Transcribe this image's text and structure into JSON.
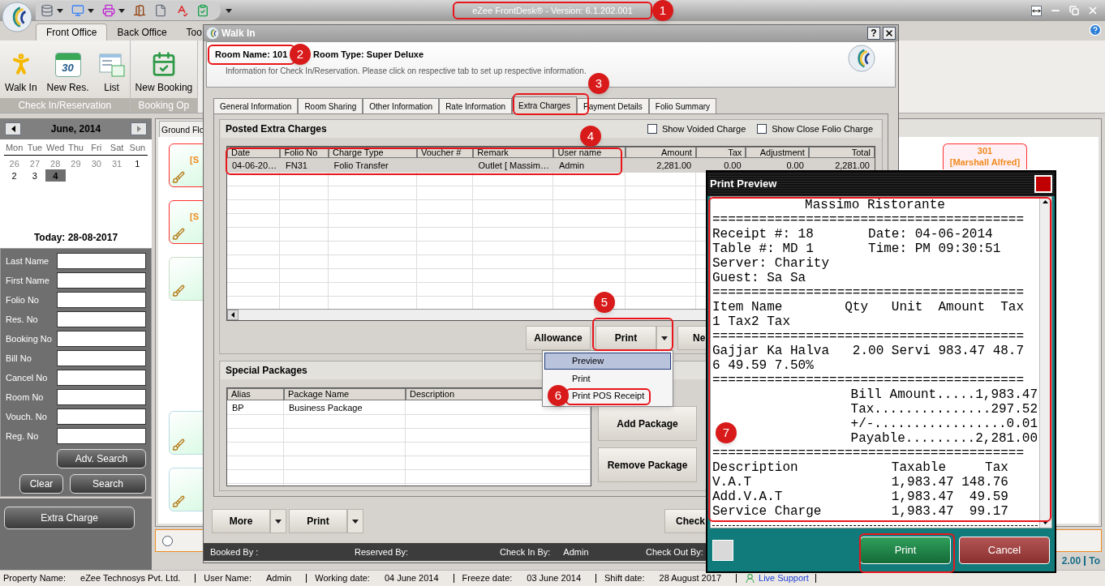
{
  "app": {
    "title": "eZee FrontDesk® - Version: 6.1.202.001"
  },
  "quick_toolbar": [
    {
      "kind": "database",
      "dropdown": true
    },
    {
      "kind": "monitor",
      "dropdown": true
    },
    {
      "kind": "printer",
      "dropdown": true
    },
    {
      "kind": "door",
      "dropdown": false
    },
    {
      "kind": "document",
      "dropdown": false
    },
    {
      "kind": "spellcheck",
      "dropdown": false
    },
    {
      "kind": "checklist",
      "dropdown": false
    }
  ],
  "ribbon_tabs": [
    {
      "label": "Front Office",
      "selected": true
    },
    {
      "label": "Back Office",
      "selected": false
    },
    {
      "label": "Too",
      "selected": false
    }
  ],
  "ribbon_groups": [
    {
      "label": "Check In/Reservation",
      "buttons": [
        {
          "kind": "walker",
          "label": "Walk In"
        },
        {
          "kind": "calendar",
          "label": "New Res.",
          "badge": "30"
        },
        {
          "kind": "list",
          "label": "List"
        }
      ]
    },
    {
      "label": "Booking Op",
      "buttons": [
        {
          "kind": "booking",
          "label": "New Booking"
        }
      ]
    }
  ],
  "calendar": {
    "month": "June, 2014",
    "weekdays": [
      "Mon",
      "Tue",
      "Wed",
      "Thu",
      "Fri",
      "Sat",
      "Sun"
    ],
    "days": [
      {
        "day": "26",
        "other_month": true,
        "selected": false
      },
      {
        "day": "27",
        "other_month": true,
        "selected": false
      },
      {
        "day": "28",
        "other_month": true,
        "selected": false
      },
      {
        "day": "29",
        "other_month": true,
        "selected": false
      },
      {
        "day": "30",
        "other_month": true,
        "selected": false
      },
      {
        "day": "31",
        "other_month": true,
        "selected": false
      },
      {
        "day": "1",
        "other_month": false,
        "selected": false
      },
      {
        "day": "2",
        "other_month": false,
        "selected": false
      },
      {
        "day": "3",
        "other_month": false,
        "selected": false
      },
      {
        "day": "4",
        "other_month": false,
        "selected": true
      }
    ],
    "today": "Today: 28-08-2017"
  },
  "search": {
    "fields": [
      "Last Name",
      "First Name",
      "Folio No",
      "Res. No",
      "Booking No",
      "Bill No",
      "Cancel No",
      "Room No",
      "Vouch. No",
      "Reg. No"
    ],
    "advanced": "Adv. Search",
    "clear": "Clear",
    "search": "Search"
  },
  "extra_charge_button": "Extra Charge",
  "floor_tab": "Ground Flo",
  "room_cards": [
    {
      "label": "[S",
      "color": "#ff3030"
    },
    {
      "label": "[S",
      "color": "#ff3030"
    },
    {
      "color": "#c8dcc8"
    },
    {
      "color": "#b8dce6"
    },
    {
      "color": "#b8dce6"
    }
  ],
  "featured_room": {
    "number": "301",
    "guest": "[Marshall Alfred]"
  },
  "bottom_strip": {
    "radio_selected": false,
    "value": "2.00",
    "label": "To"
  },
  "status_bar": [
    {
      "label": "Property Name:",
      "value": "eZee Technosys Pvt. Ltd."
    },
    {
      "label": "User Name:",
      "value": "Admin"
    },
    {
      "label": "Working date:",
      "value": "04 June 2014"
    },
    {
      "label": "Freeze date:",
      "value": "03 June 2014"
    },
    {
      "label": "Shift date:",
      "value": "28 August 2017"
    }
  ],
  "live_support": "Live Support",
  "walk_in": {
    "title": "Walk In",
    "help_button": "?",
    "room_name": "Room Name: 101",
    "room_type": "Room Type: Super Deluxe",
    "info": "Information for Check In/Reservation. Please click on respective tab to set up respective information.",
    "tabs": [
      {
        "label": "General Information",
        "selected": false
      },
      {
        "label": "Room Sharing",
        "selected": false
      },
      {
        "label": "Other Information",
        "selected": false
      },
      {
        "label": "Rate Information",
        "selected": false
      },
      {
        "label": "Extra Charges",
        "selected": true
      },
      {
        "label": "Payment Details",
        "selected": false
      },
      {
        "label": "Folio Summary",
        "selected": false
      }
    ],
    "posted_charges": {
      "title": "Posted Extra Charges",
      "options": [
        {
          "label": "Show Voided Charge",
          "checked": false
        },
        {
          "label": "Show Close Folio Charge",
          "checked": false
        }
      ],
      "columns": [
        "Date",
        "Folio No",
        "Charge Type",
        "Voucher #",
        "Remark",
        "User name",
        "Amount",
        "Tax",
        "Adjustment",
        "Total"
      ],
      "rows": [
        {
          "selected": true,
          "cells": [
            "04-06-20…",
            "FN31",
            "Folio Transfer",
            null,
            "Outlet [ Massim…",
            "Admin",
            "2,281.00",
            "0.00",
            "0.00",
            "2,281.00"
          ]
        }
      ]
    },
    "charge_buttons": [
      {
        "label": "Allowance",
        "split": false
      },
      {
        "label": "Print",
        "split": true
      },
      {
        "label": "Ne",
        "split": false
      }
    ],
    "print_menu": [
      {
        "label": "Preview",
        "selected": true
      },
      {
        "label": "Print",
        "selected": false
      },
      {
        "label": "Print POS Receipt",
        "selected": false
      }
    ],
    "packages": {
      "title": "Special Packages",
      "columns": [
        "Alias",
        "Package Name",
        "Description"
      ],
      "rows": [
        [
          "BP",
          "Business Package"
        ]
      ]
    },
    "package_buttons": [
      "Add Package",
      "Remove Package"
    ],
    "footer_buttons": [
      {
        "label": "More",
        "split": true
      },
      {
        "label": "Print",
        "split": true
      },
      {
        "label": "Check",
        "split": false
      }
    ],
    "footer_info": [
      {
        "label": "Booked By :"
      },
      {
        "label": "Reserved By:"
      },
      {
        "label": "Check In By:",
        "value": "Admin"
      },
      {
        "label": "Check Out By:"
      }
    ]
  },
  "print_preview": {
    "title": "Print Preview",
    "receipt": [
      {
        "kind": "center",
        "text": "Massimo Ristorante"
      },
      {
        "kind": "rule",
        "text": "========================================"
      },
      {
        "kind": "text",
        "text": "Receipt #: 18       Date: 04-06-2014"
      },
      {
        "kind": "text",
        "text": "Table #: MD 1       Time: PM 09:30:51"
      },
      {
        "kind": "text",
        "text": "Server: Charity"
      },
      {
        "kind": "text",
        "text": "Guest: Sa Sa"
      },
      {
        "kind": "rule",
        "text": "========================================"
      },
      {
        "kind": "text",
        "text": "Item Name        Qty   Unit  Amount  Tax"
      },
      {
        "kind": "text",
        "text": "1 Tax2 Tax"
      },
      {
        "kind": "rule",
        "text": "========================================"
      },
      {
        "kind": "text",
        "text": "Gajjar Ka Halva   2.00 Servi 983.47 48.7"
      },
      {
        "kind": "text",
        "text": "6 49.59 7.50%"
      },
      {
        "kind": "rule",
        "text": "========================================"
      },
      {
        "kind": "right",
        "text": "Bill Amount.....1,983.47"
      },
      {
        "kind": "right",
        "text": "Tax...............297.52"
      },
      {
        "kind": "right",
        "text": "+/-.................0.01"
      },
      {
        "kind": "right",
        "text": "Payable.........2,281.00"
      },
      {
        "kind": "rule",
        "text": "========================================"
      },
      {
        "kind": "text",
        "text": "Description            Taxable     Tax"
      },
      {
        "kind": "text",
        "text": "V.A.T                  1,983.47 148.76"
      },
      {
        "kind": "text",
        "text": "Add.V.A.T              1,983.47  49.59"
      },
      {
        "kind": "text",
        "text": "Service Charge         1,983.47  99.17"
      }
    ],
    "buttons": [
      {
        "label": "Print",
        "kind": "confirm"
      },
      {
        "label": "Cancel",
        "kind": "cancel"
      }
    ]
  },
  "annotations": [
    {
      "number": "1"
    },
    {
      "number": "2"
    },
    {
      "number": "3"
    },
    {
      "number": "4"
    },
    {
      "number": "5"
    },
    {
      "number": "6"
    },
    {
      "number": "7"
    }
  ]
}
